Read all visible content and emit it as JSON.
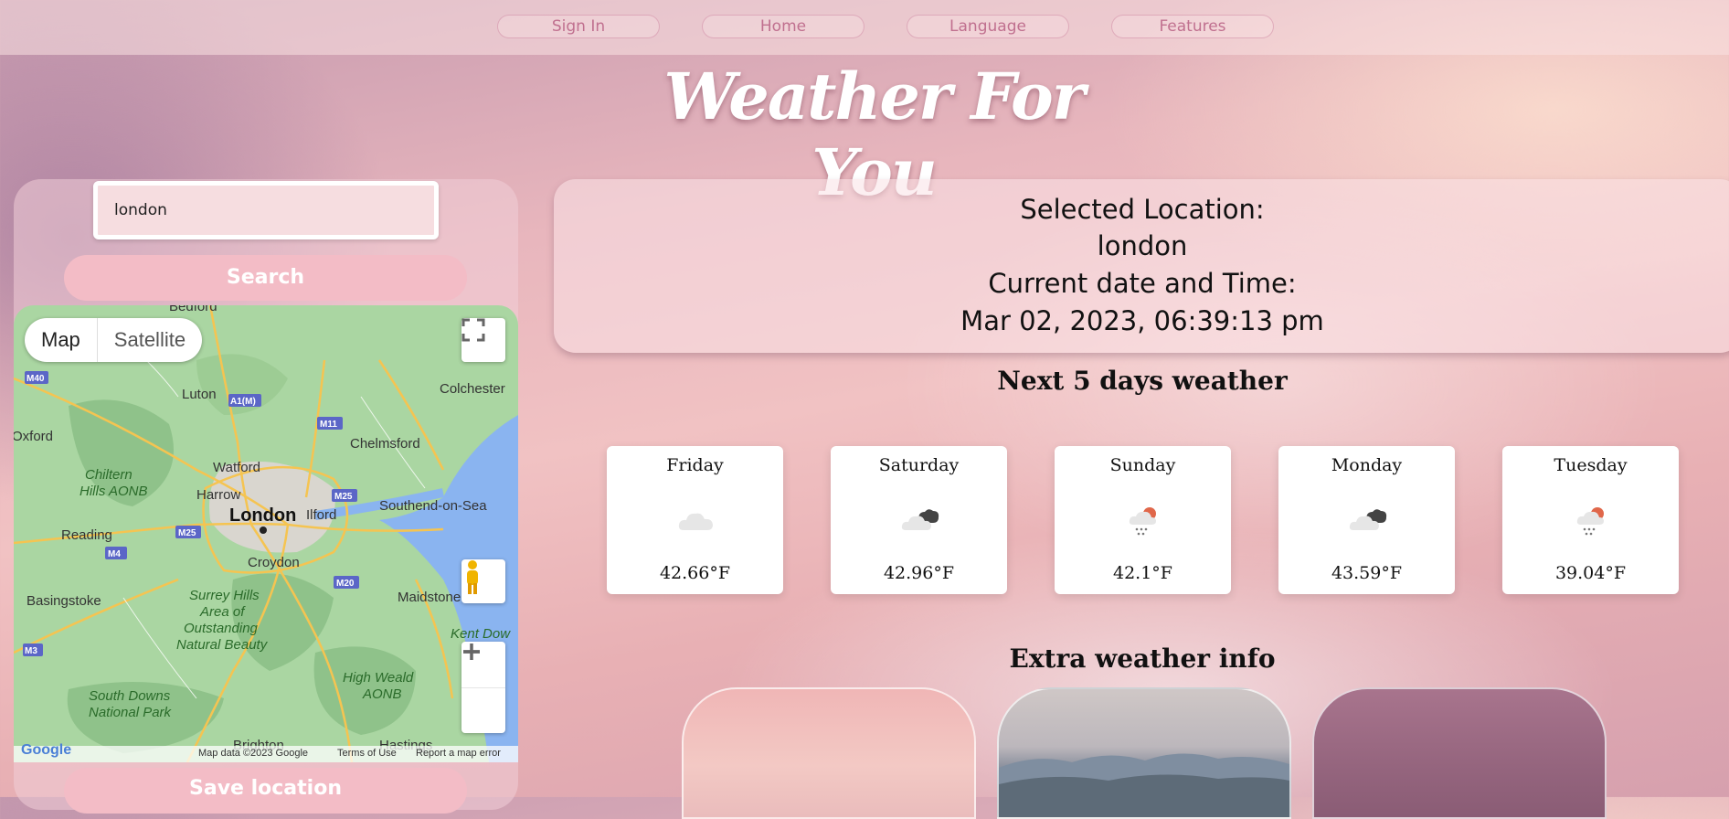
{
  "nav": {
    "items": [
      "Sign In",
      "Home",
      "Language",
      "Features"
    ]
  },
  "title": "Weather For You",
  "search": {
    "value": "london",
    "button_label": "Search",
    "save_label": "Save location"
  },
  "map": {
    "toggle": [
      "Map",
      "Satellite"
    ],
    "places": [
      "Bedford",
      "Luton",
      "Colchester",
      "Oxford",
      "Chelmsford",
      "Watford",
      "Harrow",
      "London",
      "Ilford",
      "Southend-on-Sea",
      "Reading",
      "Croydon",
      "Basingstoke",
      "Maidstone",
      "Surrey Hills Area of Outstanding Natural Beauty",
      "High Weald AONB",
      "South Downs National Park",
      "Chiltern Hills AONB",
      "Hastings",
      "Brighton",
      "Kent Dow"
    ],
    "roads": [
      "M40",
      "A1(M)",
      "M11",
      "M25",
      "M4",
      "M20",
      "M3"
    ],
    "footer": [
      "Map data ©2023 Google",
      "Terms of Use",
      "Report a map error"
    ]
  },
  "info": {
    "selected_label": "Selected Location:",
    "location": "london",
    "datetime_label": "Current date and Time:",
    "datetime": "Mar 02, 2023, 06:39:13 pm"
  },
  "forecast": {
    "title": "Next 5 days weather",
    "days": [
      {
        "day": "Friday",
        "temp": "42.66°F",
        "icon": "cloud-icon"
      },
      {
        "day": "Saturday",
        "temp": "42.96°F",
        "icon": "broken-clouds-icon"
      },
      {
        "day": "Sunday",
        "temp": "42.1°F",
        "icon": "rain-sun-icon"
      },
      {
        "day": "Monday",
        "temp": "43.59°F",
        "icon": "broken-clouds-icon"
      },
      {
        "day": "Tuesday",
        "temp": "39.04°F",
        "icon": "rain-sun-icon"
      }
    ]
  },
  "extra": {
    "title": "Extra weather info"
  }
}
